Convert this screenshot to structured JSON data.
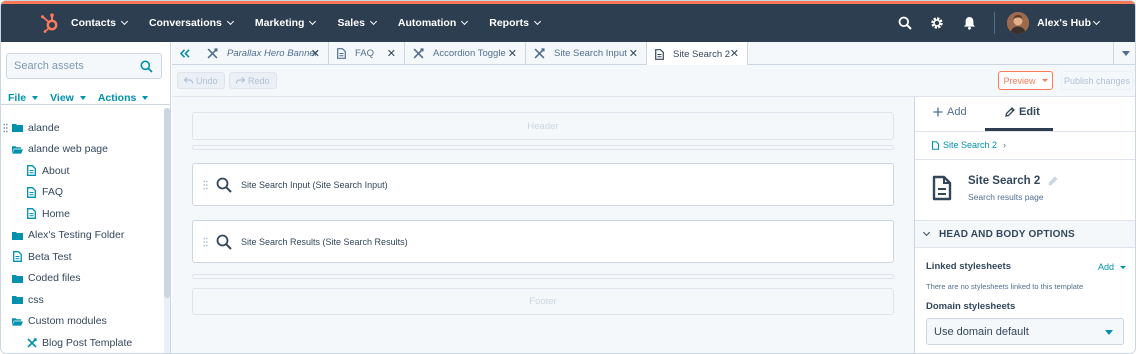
{
  "topnav": {
    "items": [
      "Contacts",
      "Conversations",
      "Marketing",
      "Sales",
      "Automation",
      "Reports"
    ],
    "account": "Alex's Hub"
  },
  "sidebar": {
    "search_placeholder": "Search assets",
    "menus": [
      "File",
      "View",
      "Actions"
    ],
    "tree": [
      {
        "label": "alande",
        "icon": "folder-icon"
      },
      {
        "label": "alande web page",
        "icon": "folder-open-icon"
      },
      {
        "label": "About",
        "icon": "page-icon"
      },
      {
        "label": "FAQ",
        "icon": "page-icon"
      },
      {
        "label": "Home",
        "icon": "page-icon"
      },
      {
        "label": "Alex's Testing Folder",
        "icon": "folder-icon"
      },
      {
        "label": "Beta Test",
        "icon": "page-icon"
      },
      {
        "label": "Coded files",
        "icon": "folder-icon"
      },
      {
        "label": "css",
        "icon": "folder-icon"
      },
      {
        "label": "Custom modules",
        "icon": "folder-open-icon"
      },
      {
        "label": "Blog Post Template",
        "icon": "module-icon"
      }
    ]
  },
  "tabs": [
    {
      "label": "Parallax Hero Banner",
      "icon": "module-icon",
      "italic": true
    },
    {
      "label": "FAQ",
      "icon": "page-icon",
      "italic": false
    },
    {
      "label": "Accordion Toggle",
      "icon": "module-icon",
      "italic": false
    },
    {
      "label": "Site Search Input",
      "icon": "module-icon",
      "italic": false
    },
    {
      "label": "Site Search 2",
      "icon": "page-icon",
      "italic": false
    }
  ],
  "toolbar": {
    "undo": "Undo",
    "redo": "Redo",
    "preview": "Preview",
    "publish": "Publish changes"
  },
  "canvas": {
    "header": "Header",
    "footer": "Footer",
    "modules": [
      "Site Search Input (Site Search Input)",
      "Site Search Results (Site Search Results)"
    ]
  },
  "panel": {
    "add_tab": "Add",
    "edit_tab": "Edit",
    "breadcrumb": "Site Search 2",
    "template_name": "Site Search 2",
    "template_type": "Search results page",
    "section_title": "HEAD AND BODY OPTIONS",
    "linked_label": "Linked stylesheets",
    "add_link": "Add",
    "linked_note": "There are no stylesheets linked to this template",
    "domain_label": "Domain stylesheets",
    "domain_value": "Use domain default"
  }
}
